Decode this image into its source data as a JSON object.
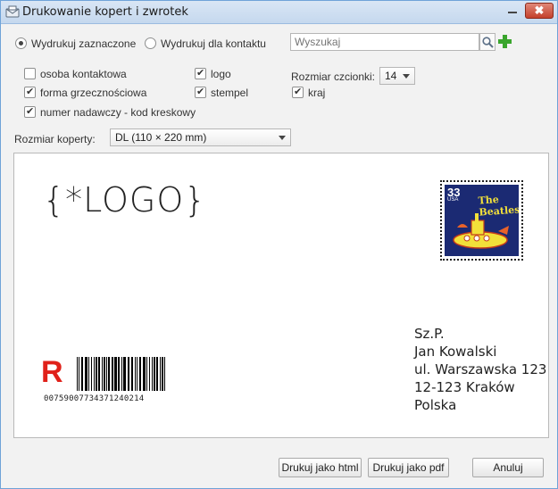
{
  "window": {
    "title": "Drukowanie kopert i zwrotek",
    "close_glyph": "✖"
  },
  "mode": {
    "selected_label": "Wydrukuj zaznaczone",
    "contact_label": "Wydrukuj dla kontaktu",
    "selected": "selected"
  },
  "search": {
    "placeholder": "Wyszukaj"
  },
  "options": {
    "contact_person": {
      "label": "osoba kontaktowa",
      "checked": false
    },
    "salutation": {
      "label": "forma grzecznościowa",
      "checked": true
    },
    "barcode": {
      "label": "numer nadawczy - kod kreskowy",
      "checked": true
    },
    "logo": {
      "label": "logo",
      "checked": true
    },
    "stamp": {
      "label": "stempel",
      "checked": true
    },
    "country": {
      "label": "kraj",
      "checked": true
    }
  },
  "font_size": {
    "label": "Rozmiar czcionki:",
    "value": "14"
  },
  "envelope_size": {
    "label": "Rozmiar koperty:",
    "value": "DL (110 × 220 mm)"
  },
  "preview": {
    "logo_placeholder": "{*LOGO}",
    "stamp": {
      "denomination": "33",
      "country": "USA",
      "title": "The Beatles"
    },
    "address_lines": [
      "Sz.P.",
      "Jan Kowalski",
      "ul. Warszawska 123",
      "12-123 Kraków",
      "Polska"
    ],
    "registered_mark": "R",
    "tracking_number": "00759007734371240214"
  },
  "buttons": {
    "print_html": "Drukuj jako html",
    "print_pdf": "Drukuj jako pdf",
    "cancel": "Anuluj"
  },
  "colors": {
    "accent": "#6fa3d8",
    "registered_red": "#e0211a",
    "add_green": "#3aa52d",
    "stamp_blue": "#1b2a73",
    "stamp_yellow": "#f2e03a"
  },
  "icons": {
    "title": "envelope-printer-icon",
    "search": "magnifier-icon",
    "add": "plus-icon",
    "close": "close-icon",
    "minimize": "minimize-icon"
  }
}
